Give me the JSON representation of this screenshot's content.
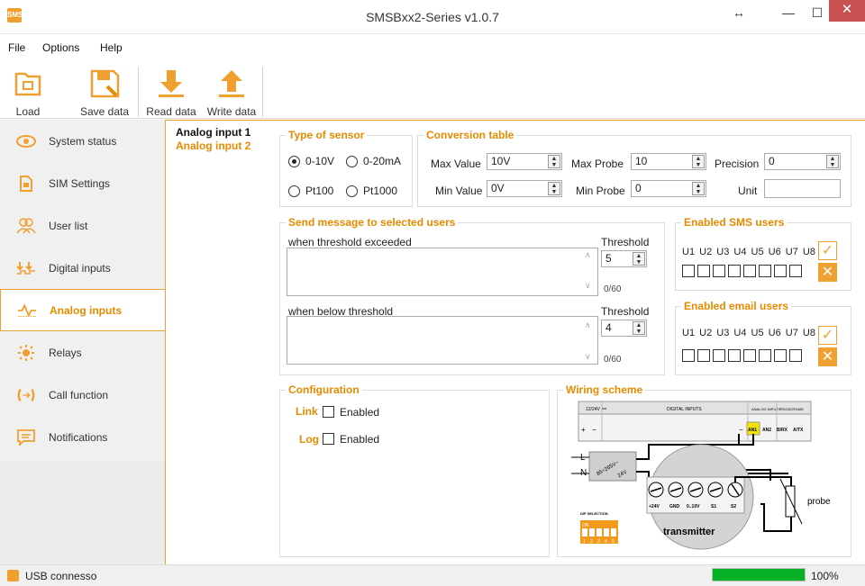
{
  "window": {
    "title": "SMSBxx2-Series v1.0.7",
    "app_icon_text": "SMS"
  },
  "menu": [
    "File",
    "Options",
    "Help"
  ],
  "toolbar": {
    "load": "Load data",
    "save": "Save data",
    "read": "Read data",
    "write": "Write data"
  },
  "sidebar": {
    "items": [
      {
        "label": "System status",
        "icon": "eye-icon"
      },
      {
        "label": "SIM Settings",
        "icon": "sim-icon"
      },
      {
        "label": "User list",
        "icon": "users-icon"
      },
      {
        "label": "Digital inputs",
        "icon": "digital-inputs-icon"
      },
      {
        "label": "Analog inputs",
        "icon": "analog-wave-icon"
      },
      {
        "label": "Relays",
        "icon": "relay-sun-icon"
      },
      {
        "label": "Call function",
        "icon": "call-icon"
      },
      {
        "label": "Notifications",
        "icon": "notification-icon"
      }
    ]
  },
  "inputs": [
    "Analog input 1",
    "Analog input 2"
  ],
  "sensor": {
    "title": "Type of sensor",
    "options": [
      "0-10V",
      "0-20mA",
      "Pt100",
      "Pt1000"
    ],
    "selected": "0-10V"
  },
  "conversion": {
    "title": "Conversion table",
    "max_value_label": "Max Value",
    "max_value": "10V",
    "min_value_label": "Min Value",
    "min_value": "0V",
    "max_probe_label": "Max Probe",
    "max_probe": "10",
    "min_probe_label": "Min Probe",
    "min_probe": "0",
    "precision_label": "Precision",
    "precision": "0",
    "unit_label": "Unit",
    "unit": ""
  },
  "send_message": {
    "title": "Send message to selected users",
    "exceeded_label": "when threshold exceeded",
    "below_label": "when below threshold",
    "threshold_label": "Threshold",
    "threshold_high": "5",
    "threshold_low": "4",
    "counter_high": "0/60",
    "counter_low": "0/60"
  },
  "sms_users": {
    "title": "Enabled SMS users",
    "users": [
      "U1",
      "U2",
      "U3",
      "U4",
      "U5",
      "U6",
      "U7",
      "U8"
    ]
  },
  "email_users": {
    "title": "Enabled email users",
    "users": [
      "U1",
      "U2",
      "U3",
      "U4",
      "U5",
      "U6",
      "U7",
      "U8"
    ]
  },
  "configuration": {
    "title": "Configuration",
    "link_label": "Link",
    "log_label": "Log",
    "enabled_label": "Enabled"
  },
  "wiring": {
    "title": "Wiring scheme",
    "voltage": "12/24V ==",
    "digital": "DIGITAL INPUTS",
    "analog": "ANALOG INPUTS",
    "rs": "RS232/RS485",
    "an1": "AN1",
    "an2": "AN2",
    "brx": "B/RX",
    "atx": "A/TX",
    "plus": "+",
    "minus": "−",
    "L": "L",
    "N": "N",
    "psu1": "85÷265V~",
    "psu2": "24V",
    "term_labels": [
      "+24V",
      "GND",
      "0..10V",
      "S1",
      "S2"
    ],
    "transmitter": "transmitter",
    "probe": "probe",
    "dip": "DIP SELECTION",
    "dip_on": "ON",
    "dip_nums": [
      "1",
      "2",
      "3",
      "4",
      "5"
    ]
  },
  "status": {
    "text": "USB connesso",
    "progress_percent": 100,
    "progress_label": "100%"
  },
  "colors": {
    "accent": "#e68a00",
    "progress": "#06b025",
    "close": "#c75050"
  }
}
